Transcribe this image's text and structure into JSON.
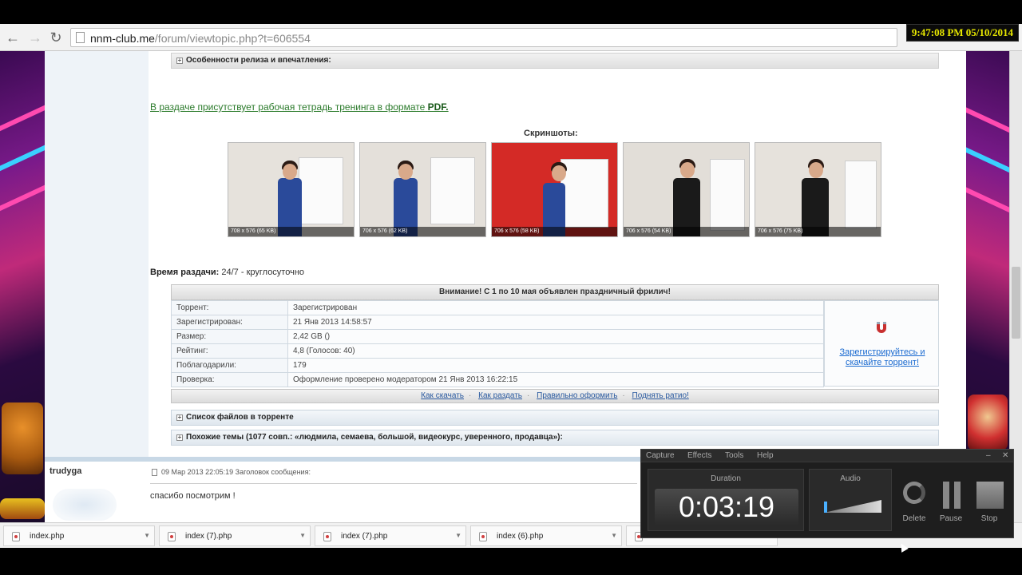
{
  "overlay": {
    "clock": "9:47:08 PM 05/10/2014"
  },
  "browser": {
    "url_domain": "nnm-club.me",
    "url_rest": "/forum/viewtopic.php?t=606554"
  },
  "post": {
    "features_heading": "Особенности релиза и впечатления:",
    "pdf_text": "В раздаче присутствует рабочая тетрадь тренинга в формате",
    "pdf_bold": "PDF.",
    "screenshots_title": "Скриншоты:",
    "screenshots": [
      {
        "caption": "708 x 576 (65 KB)",
        "wall": "#e6e2dc"
      },
      {
        "caption": "706 x 576 (62 KB)",
        "wall": "#e4e0da"
      },
      {
        "caption": "706 x 576 (58 KB)",
        "wall": "#d42a26"
      },
      {
        "caption": "706 x 576 (54 KB)",
        "wall": "#e2ded8"
      },
      {
        "caption": "706 x 576 (75 KB)",
        "wall": "#e6e2dc"
      }
    ],
    "time_label": "Время раздачи:",
    "time_value": "24/7 - круглосуточно"
  },
  "torrent": {
    "notice": "Внимание! С 1 по 10 мая объявлен праздничный фрилич!",
    "rows": [
      {
        "key": "Торрент:",
        "value": "Зарегистрирован"
      },
      {
        "key": "Зарегистрирован:",
        "value": "21 Янв 2013 14:58:57"
      },
      {
        "key": "Размер:",
        "value": "2,42 GB  ()"
      },
      {
        "key": "Рейтинг:",
        "value": "4,8 (Голосов: 40)"
      },
      {
        "key": "Поблагодарили:",
        "value": "179"
      },
      {
        "key": "Проверка:",
        "value": "Оформление проверено модератором 21 Янв 2013 16:22:15"
      }
    ],
    "register_link": "Зарегистрируйтесь и скачайте торрент!",
    "links": [
      "Как скачать",
      "Как раздать",
      "Правильно оформить",
      "Поднять ратио!"
    ],
    "files_heading": "Список файлов в торренте",
    "similar_heading": "Похожие темы (1077 совп.: «людмила, семаева, большой, видеокурс, уверенного, продавца»):"
  },
  "reply": {
    "author": "trudyga",
    "meta": "09 Мар 2013 22:05:19   Заголовок сообщения:",
    "text": "спасибо посмотрим !"
  },
  "downloads": [
    {
      "name": "index.php"
    },
    {
      "name": "index (7).php"
    },
    {
      "name": "index (7).php"
    },
    {
      "name": "index (6).php"
    }
  ],
  "recorder": {
    "menu": [
      "Capture",
      "Effects",
      "Tools",
      "Help"
    ],
    "duration_label": "Duration",
    "duration": "0:03:19",
    "audio_label": "Audio",
    "delete_label": "Delete",
    "pause_label": "Pause",
    "stop_label": "Stop"
  }
}
